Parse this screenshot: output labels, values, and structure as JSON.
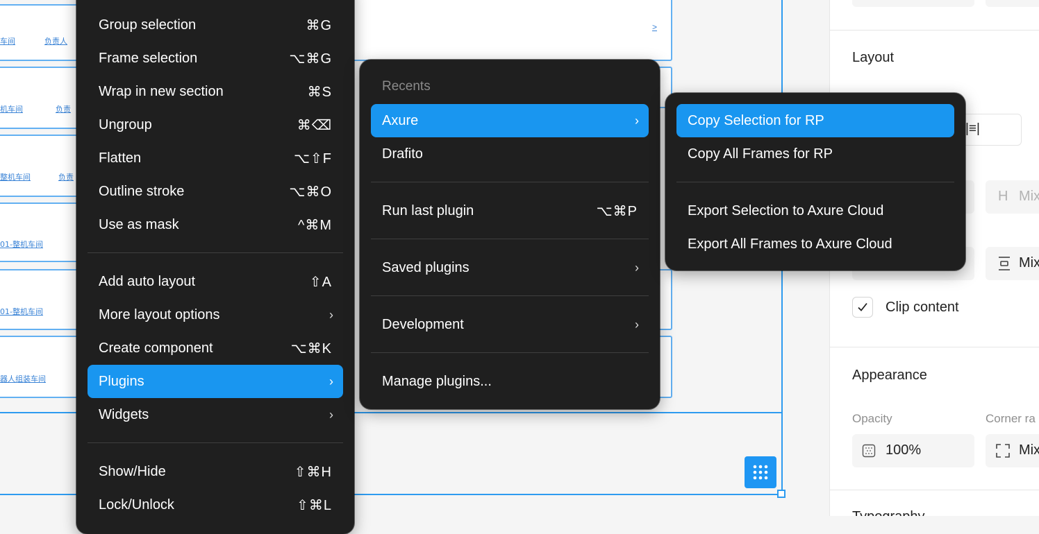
{
  "canvas": {
    "row_labels": [
      "车间",
      "机车间",
      "整机车间",
      "01-整机车间",
      "01-整机车间",
      "器人组装车间"
    ],
    "row_labels_second": [
      "负责人",
      "负责",
      "负责",
      ""
    ],
    "card_link": ">"
  },
  "context_menu": {
    "items": [
      {
        "label": "Group selection",
        "shortcut": "⌘G"
      },
      {
        "label": "Frame selection",
        "shortcut": "⌥⌘G"
      },
      {
        "label": "Wrap in new section",
        "shortcut": "⌘S"
      },
      {
        "label": "Ungroup",
        "shortcut": "⌘⌫"
      },
      {
        "label": "Flatten",
        "shortcut": "⌥⇧F"
      },
      {
        "label": "Outline stroke",
        "shortcut": "⌥⌘O"
      },
      {
        "label": "Use as mask",
        "shortcut": "^⌘M"
      },
      {
        "label": "Add auto layout",
        "shortcut": "⇧A"
      },
      {
        "label": "More layout options",
        "shortcut": "›"
      },
      {
        "label": "Create component",
        "shortcut": "⌥⌘K"
      },
      {
        "label": "Plugins",
        "shortcut": "›"
      },
      {
        "label": "Widgets",
        "shortcut": "›"
      },
      {
        "label": "Show/Hide",
        "shortcut": "⇧⌘H"
      },
      {
        "label": "Lock/Unlock",
        "shortcut": "⇧⌘L"
      }
    ]
  },
  "plugins_menu": {
    "header": "Recents",
    "items": [
      {
        "label": "Axure",
        "shortcut": "›"
      },
      {
        "label": "Drafito",
        "shortcut": ""
      },
      {
        "label": "Run last plugin",
        "shortcut": "⌥⌘P"
      },
      {
        "label": "Saved plugins",
        "shortcut": "›"
      },
      {
        "label": "Development",
        "shortcut": "›"
      },
      {
        "label": "Manage plugins...",
        "shortcut": ""
      }
    ]
  },
  "axure_menu": {
    "items": [
      {
        "label": "Copy Selection for RP"
      },
      {
        "label": "Copy All Frames for RP"
      },
      {
        "label": "Export Selection to Axure Cloud"
      },
      {
        "label": "Export All Frames to Axure Cloud"
      }
    ]
  },
  "panel": {
    "layout_title": "Layout",
    "align_glyph": "|≡|",
    "h_label": "H",
    "h_value": "Mix",
    "gap_value": "Mix",
    "clip_content": "Clip content",
    "clip_checked": true,
    "appearance_title": "Appearance",
    "opacity_label": "Opacity",
    "opacity_value": "100%",
    "corner_label": "Corner ra",
    "corner_value": "Mix",
    "typography_title": "Typography"
  },
  "colors": {
    "accent": "#1996f0",
    "menu_bg": "#1f1f1f",
    "selection_stroke": "#2d9bf0"
  }
}
